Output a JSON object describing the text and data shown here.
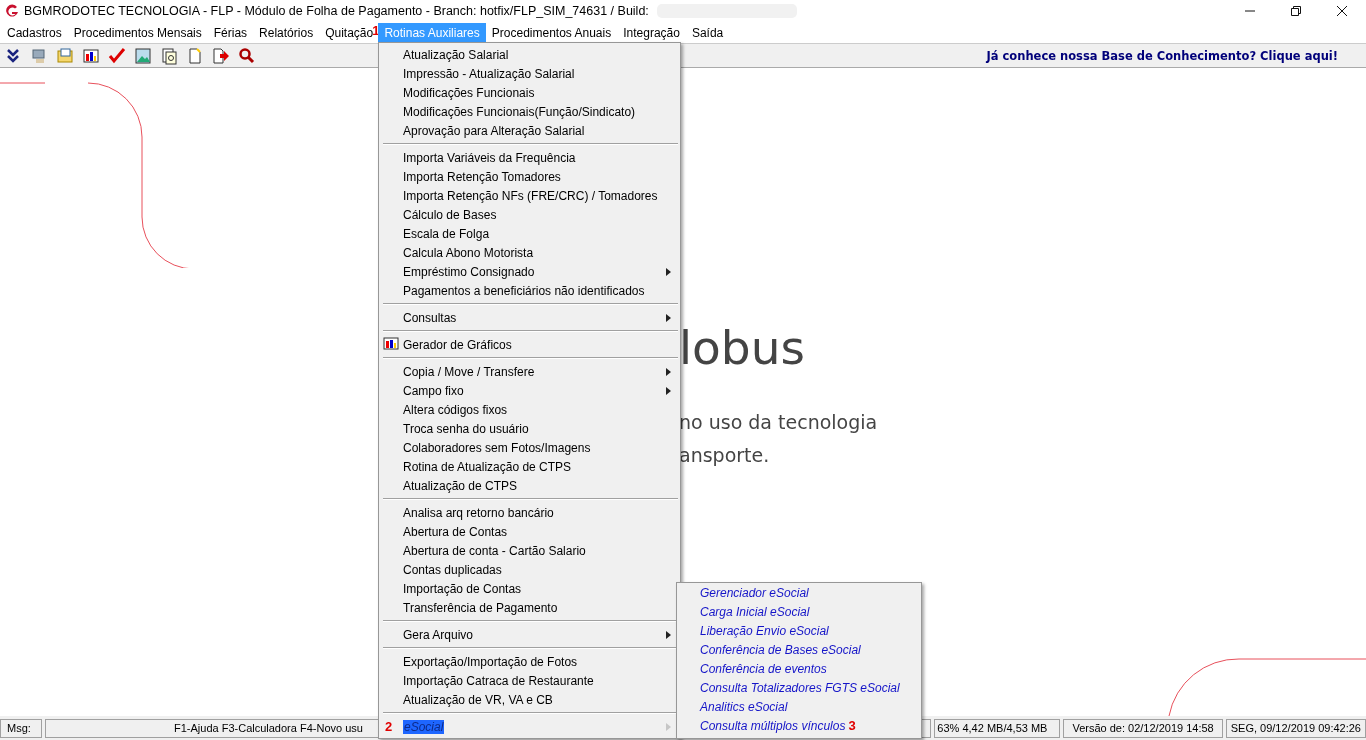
{
  "window": {
    "title": "BGMRODOTEC TECNOLOGIA - FLP - Módulo de Folha de Pagamento - Branch: hotfix/FLP_SIM_74631 / Build:"
  },
  "menubar": [
    {
      "label": "Cadastros",
      "selected": false
    },
    {
      "label": "Procedimentos Mensais",
      "selected": false
    },
    {
      "label": "Férias",
      "selected": false
    },
    {
      "label": "Relatórios",
      "selected": false
    },
    {
      "label": "Quitação",
      "selected": false,
      "marker": "1"
    },
    {
      "label": "Rotinas Auxiliares",
      "selected": true
    },
    {
      "label": "Procedimentos Anuais",
      "selected": false
    },
    {
      "label": "Integração",
      "selected": false
    },
    {
      "label": "Saída",
      "selected": false
    }
  ],
  "knowledge_link": "Já conhece nossa Base de Conhecimento? Clique aqui!",
  "hero": {
    "title": "lobus",
    "lines": [
      "no uso da tecnologia",
      "ansporte."
    ]
  },
  "menu_groups": [
    [
      {
        "label": "Atualização Salarial",
        "submenu": false,
        "icon": false,
        "selected": false
      },
      {
        "label": "Impressão - Atualização Salarial",
        "submenu": false,
        "icon": false,
        "selected": false
      },
      {
        "label": "Modificações Funcionais",
        "submenu": false,
        "icon": false,
        "selected": false
      },
      {
        "label": "Modificações Funcionais(Função/Sindicato)",
        "submenu": false,
        "icon": false,
        "selected": false
      },
      {
        "label": "Aprovação para Alteração Salarial",
        "submenu": false,
        "icon": false,
        "selected": false
      }
    ],
    [
      {
        "label": "Importa Variáveis da Frequência",
        "submenu": false,
        "icon": false,
        "selected": false
      },
      {
        "label": "Importa Retenção Tomadores",
        "submenu": false,
        "icon": false,
        "selected": false
      },
      {
        "label": "Importa Retenção NFs (FRE/CRC) / Tomadores",
        "submenu": false,
        "icon": false,
        "selected": false
      },
      {
        "label": "Cálculo de Bases",
        "submenu": false,
        "icon": false,
        "selected": false
      },
      {
        "label": "Escala de Folga",
        "submenu": false,
        "icon": false,
        "selected": false
      },
      {
        "label": "Calcula Abono Motorista",
        "submenu": false,
        "icon": false,
        "selected": false
      },
      {
        "label": "Empréstimo Consignado",
        "submenu": true,
        "icon": false,
        "selected": false
      },
      {
        "label": "Pagamentos a beneficiários não identificados",
        "submenu": false,
        "icon": false,
        "selected": false
      }
    ],
    [
      {
        "label": "Consultas",
        "submenu": true,
        "icon": false,
        "selected": false
      }
    ],
    [
      {
        "label": "Gerador de Gráficos",
        "submenu": false,
        "icon": true,
        "selected": false
      }
    ],
    [
      {
        "label": "Copia / Move / Transfere",
        "submenu": true,
        "icon": false,
        "selected": false
      },
      {
        "label": "Campo fixo",
        "submenu": true,
        "icon": false,
        "selected": false
      },
      {
        "label": "Altera códigos fixos",
        "submenu": false,
        "icon": false,
        "selected": false
      },
      {
        "label": "Troca senha do usuário",
        "submenu": false,
        "icon": false,
        "selected": false
      },
      {
        "label": "Colaboradores sem Fotos/Imagens",
        "submenu": false,
        "icon": false,
        "selected": false
      },
      {
        "label": "Rotina de Atualização de CTPS",
        "submenu": false,
        "icon": false,
        "selected": false
      },
      {
        "label": "Atualização de CTPS",
        "submenu": false,
        "icon": false,
        "selected": false
      }
    ],
    [
      {
        "label": "Analisa arq retorno bancário",
        "submenu": false,
        "icon": false,
        "selected": false
      },
      {
        "label": "Abertura de Contas",
        "submenu": false,
        "icon": false,
        "selected": false
      },
      {
        "label": "Abertura de conta - Cartão Salario",
        "submenu": false,
        "icon": false,
        "selected": false
      },
      {
        "label": "Contas duplicadas",
        "submenu": false,
        "icon": false,
        "selected": false
      },
      {
        "label": "Importação de Contas",
        "submenu": false,
        "icon": false,
        "selected": false
      },
      {
        "label": "Transferência de Pagamento",
        "submenu": false,
        "icon": false,
        "selected": false
      }
    ],
    [
      {
        "label": "Gera Arquivo",
        "submenu": true,
        "icon": false,
        "selected": false
      }
    ],
    [
      {
        "label": "Exportação/Importação de Fotos",
        "submenu": false,
        "icon": false,
        "selected": false
      },
      {
        "label": "Importação Catraca de Restaurante",
        "submenu": false,
        "icon": false,
        "selected": false
      },
      {
        "label": "Atualização de VR, VA e CB",
        "submenu": false,
        "icon": false,
        "selected": false
      }
    ],
    [
      {
        "label": "eSocial",
        "submenu": true,
        "icon": false,
        "selected": true,
        "marker": "2"
      }
    ]
  ],
  "submenu": [
    {
      "label": "Gerenciador eSocial"
    },
    {
      "label": "Carga Inicial eSocial"
    },
    {
      "label": "Liberação Envio eSocial"
    },
    {
      "label": "Conferência de Bases eSocial"
    },
    {
      "label": "Conferência de eventos"
    },
    {
      "label": "Consulta Totalizadores FGTS eSocial"
    },
    {
      "label": "Analitics eSocial"
    },
    {
      "label": "Consulta múltiplos vínculos",
      "marker": "3"
    }
  ],
  "status_bar": {
    "msg_label": "Msg:",
    "msg": "F1-Ajuda F3-Calculadora F4-Novo usu",
    "memory": "63% 4,42 MB/4,53 MB",
    "version": "Versão de: 02/12/2019 14:58",
    "datetime": "SEG, 09/12/2019 09:42:26"
  }
}
